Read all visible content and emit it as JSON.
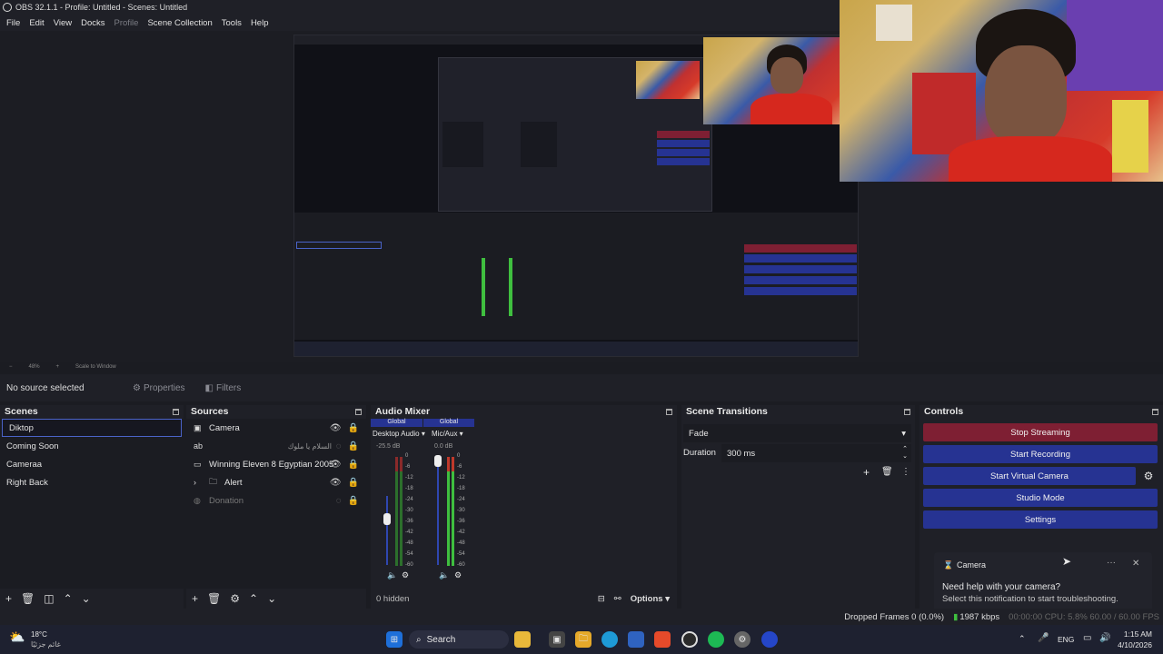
{
  "window": {
    "title": "OBS 32.1.1 - Profile: Untitled - Scenes: Untitled"
  },
  "menu": [
    "File",
    "Edit",
    "View",
    "Docks",
    "Profile",
    "Scene Collection",
    "Tools",
    "Help"
  ],
  "preview": {
    "zoom": "48%",
    "scale_mode": "Scale to Window"
  },
  "source_bar": {
    "status": "No source selected",
    "properties": "Properties",
    "filters": "Filters"
  },
  "scenes": {
    "title": "Scenes",
    "items": [
      "Diktop",
      "Coming Soon",
      "Cameraa",
      "Right Back"
    ],
    "selected": 0
  },
  "sources": {
    "title": "Sources",
    "items": [
      {
        "name": "Camera",
        "icon": "camera-icon",
        "visible": true,
        "locked": true
      },
      {
        "name": "السلام يا ملوك",
        "icon": "text-icon",
        "visible": false,
        "locked": true
      },
      {
        "name": "Winning Eleven 8 Egyptian 2005",
        "icon": "display-icon",
        "visible": true,
        "locked": true
      },
      {
        "name": "Alert",
        "icon": "folder-icon",
        "visible": true,
        "locked": true
      },
      {
        "name": "Donation",
        "icon": "browser-icon",
        "visible": false,
        "locked": true
      }
    ]
  },
  "audio": {
    "title": "Audio Mixer",
    "channels": [
      {
        "badge": "Global",
        "name": "Desktop Audio",
        "db": "-25.5 dB"
      },
      {
        "badge": "Global",
        "name": "Mic/Aux",
        "db": "0.0 dB"
      }
    ],
    "ticks": [
      "0",
      "-6",
      "-12",
      "-18",
      "-24",
      "-30",
      "-36",
      "-42",
      "-48",
      "-54",
      "-60"
    ],
    "hidden": "0 hidden",
    "options": "Options"
  },
  "transitions": {
    "title": "Scene Transitions",
    "selected": "Fade",
    "duration_label": "Duration",
    "duration_value": "300 ms"
  },
  "controls": {
    "title": "Controls",
    "stop_streaming": "Stop Streaming",
    "start_recording": "Start Recording",
    "start_virtual_camera": "Start Virtual Camera",
    "studio_mode": "Studio Mode",
    "settings": "Settings"
  },
  "notification": {
    "app": "Camera",
    "title": "Need help with your camera?",
    "body": "Select this notification to start troubleshooting."
  },
  "status": {
    "dropped": "Dropped Frames 0 (0.0%)",
    "bitrate": "1987 kbps",
    "extra": "00:00:00   CPU: 5.8%   60.00 / 60.00 FPS"
  },
  "taskbar": {
    "weather_temp": "18°C",
    "weather_text": "غائم جزئيًا",
    "search": "Search",
    "language": "ENG",
    "time": "1:15 AM",
    "date": "4/10/2026"
  },
  "colors": {
    "accent_blue": "#263392",
    "stop_red": "#7e1f33",
    "meter_green": "#3fbf3f",
    "meter_red": "#c0392b"
  }
}
